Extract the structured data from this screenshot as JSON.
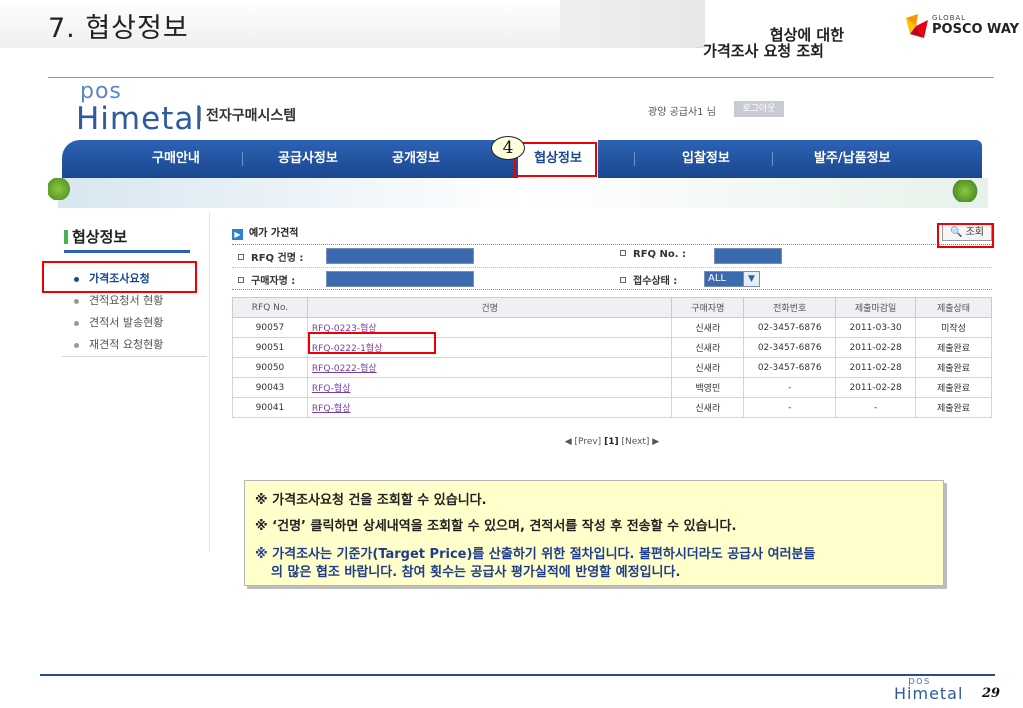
{
  "slide": {
    "title": "7. 협상정보",
    "subtitle_line1": "협상에 대한",
    "subtitle_line2": "가격조사 요청 조회",
    "posco_global": "GLOBAL",
    "posco_name": "POSCO WAY",
    "step_badge": "4",
    "page_number": "29"
  },
  "brand": {
    "pos": "pos",
    "himetal": "Himetal",
    "separator": "|",
    "system_name": "전자구매시스템"
  },
  "user": {
    "greeting": "광양 공급사1 님",
    "logout_label": "로그아웃"
  },
  "nav": {
    "items": [
      {
        "label": "구매안내"
      },
      {
        "label": "공급사정보"
      },
      {
        "label": "공개정보"
      },
      {
        "label": "협상정보"
      },
      {
        "label": "입찰정보"
      },
      {
        "label": "발주/납품정보"
      }
    ]
  },
  "sidebar": {
    "title": "협상정보",
    "items": [
      {
        "label": "가격조사요청"
      },
      {
        "label": "견적요청서 현황"
      },
      {
        "label": "견적서 발송현황"
      },
      {
        "label": "재견적 요청현황"
      }
    ]
  },
  "main": {
    "section_title": "예가 가견적",
    "search_button": "조회",
    "filters": {
      "rfq_name_label": "RFQ 건명 :",
      "rfq_no_label": "RFQ No. :",
      "buyer_label": "구매자명 :",
      "status_label": "접수상태 :",
      "status_value": "ALL"
    },
    "table": {
      "headers": [
        "RFQ No.",
        "건명",
        "구매자명",
        "전화번호",
        "제출마감일",
        "제출상태"
      ],
      "rows": [
        [
          "90057",
          "RFQ-0223-협상",
          "신새라",
          "02-3457-6876",
          "2011-03-30",
          "미작성"
        ],
        [
          "90051",
          "RFQ-0222-1협상",
          "신새라",
          "02-3457-6876",
          "2011-02-28",
          "제출완료"
        ],
        [
          "90050",
          "RFQ-0222-협상",
          "신새라",
          "02-3457-6876",
          "2011-02-28",
          "제출완료"
        ],
        [
          "90043",
          "RFQ-협상",
          "백영민",
          "-",
          "2011-02-28",
          "제출완료"
        ],
        [
          "90041",
          "RFQ-협상",
          "신새라",
          "-",
          "-",
          "제출완료"
        ]
      ]
    },
    "pager": {
      "prev": "◀ [Prev]",
      "current": "[1]",
      "next": "[Next] ▶"
    }
  },
  "notice": {
    "line1": "※ 가격조사요청 건을 조회할 수 있습니다.",
    "line2": "※ ‘건명’ 클릭하면 상세내역을 조회할 수 있으며, 견적서를 작성 후 전송할 수 있습니다.",
    "line3": "※ 가격조사는 기준가(Target Price)를 산출하기 위한 절차입니다. 불편하시더라도 공급사 여러분들",
    "line4": "의 많은 협조 바랍니다. 참여 횟수는 공급사 평가실적에 반영할 예정입니다."
  },
  "colors": {
    "nav_blue": "#1a4790",
    "callout_red": "#e00000",
    "notice_bg": "#ffffcc",
    "input_fill": "#3c6ab0"
  }
}
